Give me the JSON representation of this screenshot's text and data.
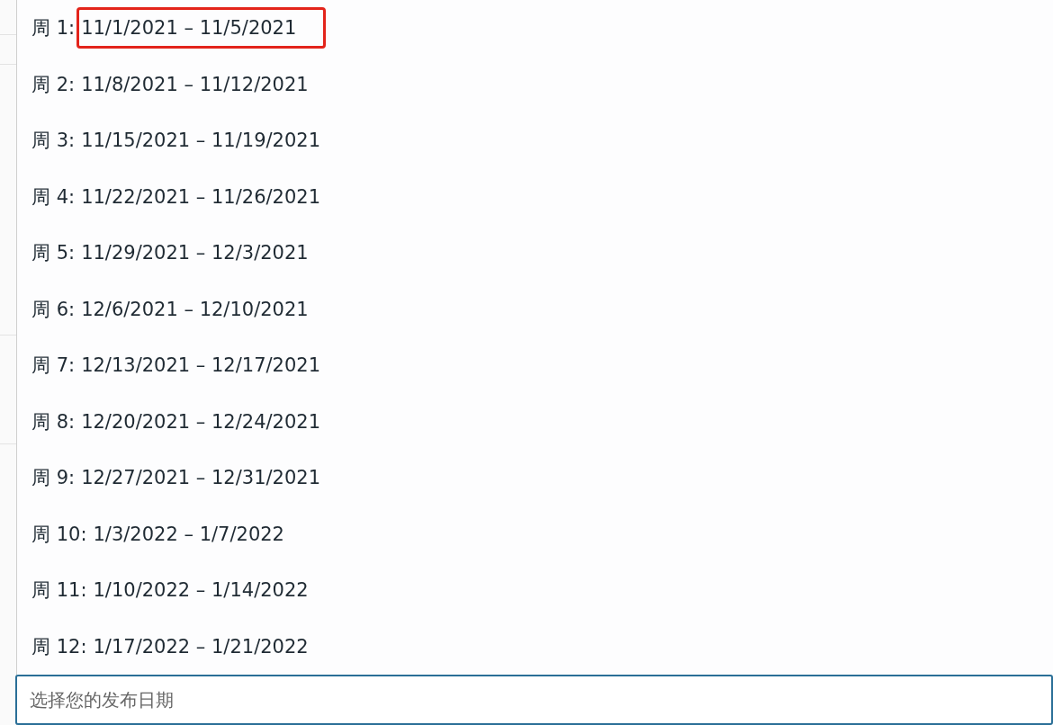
{
  "options": [
    {
      "prefix": "周 1:",
      "range": "11/1/2021 – 11/5/2021",
      "highlighted": true
    },
    {
      "prefix": "周 2:",
      "range": "11/8/2021 – 11/12/2021",
      "highlighted": false
    },
    {
      "prefix": "周 3:",
      "range": "11/15/2021 – 11/19/2021",
      "highlighted": false
    },
    {
      "prefix": "周 4:",
      "range": "11/22/2021 – 11/26/2021",
      "highlighted": false
    },
    {
      "prefix": "周 5:",
      "range": "11/29/2021 – 12/3/2021",
      "highlighted": false
    },
    {
      "prefix": "周 6:",
      "range": "12/6/2021 – 12/10/2021",
      "highlighted": false
    },
    {
      "prefix": "周 7:",
      "range": "12/13/2021 – 12/17/2021",
      "highlighted": false
    },
    {
      "prefix": "周 8:",
      "range": "12/20/2021 – 12/24/2021",
      "highlighted": false
    },
    {
      "prefix": "周 9:",
      "range": "12/27/2021 – 12/31/2021",
      "highlighted": false
    },
    {
      "prefix": "周 10:",
      "range": "1/3/2022 – 1/7/2022",
      "highlighted": false
    },
    {
      "prefix": "周 11:",
      "range": "1/10/2022 – 1/14/2022",
      "highlighted": false
    },
    {
      "prefix": "周 12:",
      "range": "1/17/2022 – 1/21/2022",
      "highlighted": false
    }
  ],
  "date_field": {
    "placeholder": "选择您的发布日期"
  }
}
